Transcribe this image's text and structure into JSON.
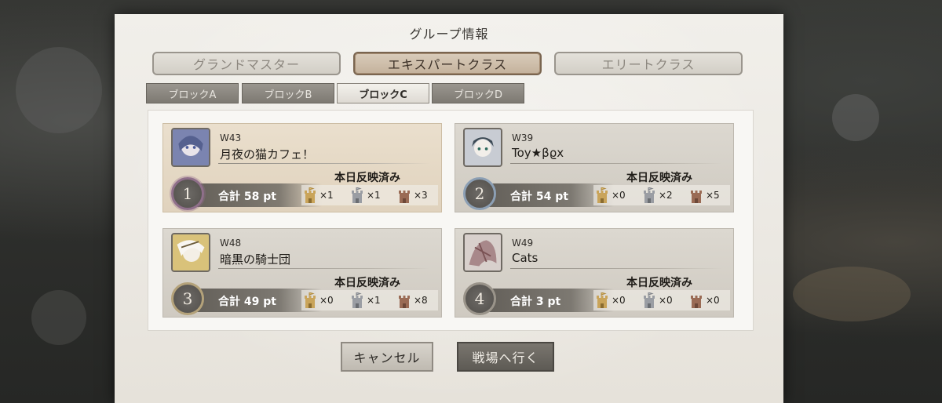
{
  "dialog": {
    "title": "グループ情報"
  },
  "tabs": [
    {
      "label": "グランドマスター",
      "active": false
    },
    {
      "label": "エキスパートクラス",
      "active": true
    },
    {
      "label": "エリートクラス",
      "active": false
    }
  ],
  "blocks": [
    {
      "label": "ブロックA",
      "active": false
    },
    {
      "label": "ブロックB",
      "active": false
    },
    {
      "label": "ブロックC",
      "active": true
    },
    {
      "label": "ブロックD",
      "active": false
    }
  ],
  "groups": [
    {
      "rank": "1",
      "world": "W43",
      "name": "月夜の猫カフェ！",
      "status": "本日反映済み",
      "score": "合計 58 pt",
      "towers": {
        "gold": "×1",
        "silver": "×1",
        "bronze": "×3"
      }
    },
    {
      "rank": "2",
      "world": "W39",
      "name": "Toy★βϱx",
      "status": "本日反映済み",
      "score": "合計 54 pt",
      "towers": {
        "gold": "×0",
        "silver": "×2",
        "bronze": "×5"
      }
    },
    {
      "rank": "3",
      "world": "W48",
      "name": "暗黒の騎士団",
      "status": "本日反映済み",
      "score": "合計 49 pt",
      "towers": {
        "gold": "×0",
        "silver": "×1",
        "bronze": "×8"
      }
    },
    {
      "rank": "4",
      "world": "W49",
      "name": "Cats",
      "status": "本日反映済み",
      "score": "合計 3 pt",
      "towers": {
        "gold": "×0",
        "silver": "×0",
        "bronze": "×0"
      }
    }
  ],
  "buttons": {
    "cancel": "キャンセル",
    "go": "戦場へ行く"
  },
  "colors": {
    "tower_gold": "#c9a45a",
    "tower_silver": "#9a9da3",
    "tower_bronze": "#9a6b55"
  }
}
